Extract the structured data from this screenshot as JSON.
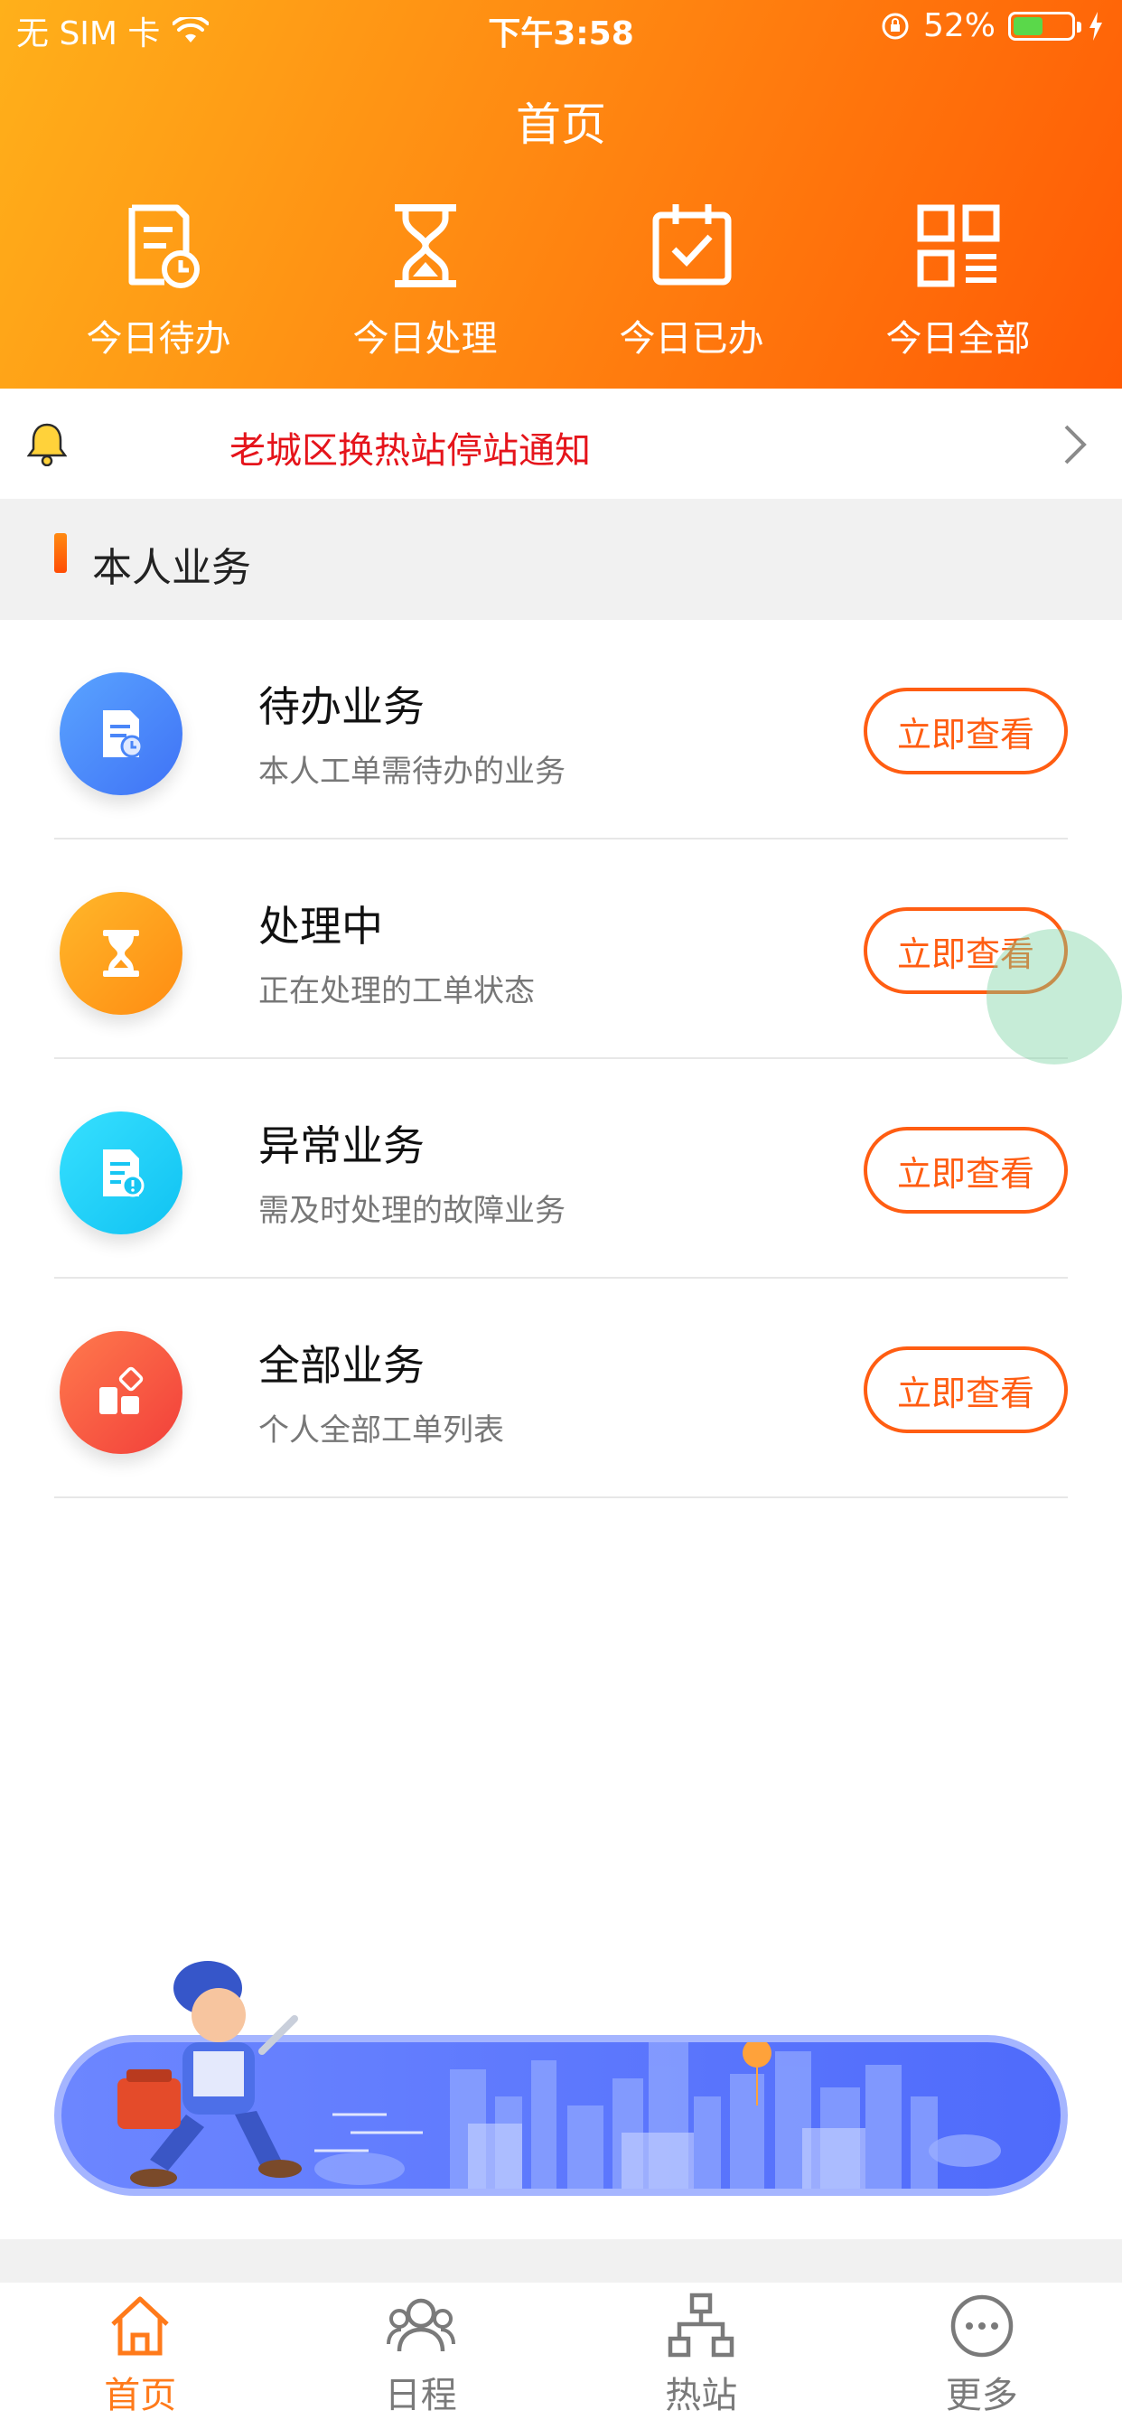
{
  "status_bar": {
    "carrier": "无 SIM 卡",
    "time": "下午3:58",
    "battery_percent": "52%",
    "battery_level": 0.52
  },
  "header": {
    "title": "首页",
    "quick_actions": [
      {
        "label": "今日待办",
        "icon": "document-clock-icon"
      },
      {
        "label": "今日处理",
        "icon": "hourglass-icon"
      },
      {
        "label": "今日已办",
        "icon": "calendar-check-icon"
      },
      {
        "label": "今日全部",
        "icon": "grid-menu-icon"
      }
    ]
  },
  "notice": {
    "text": "老城区换热站停站通知",
    "icon": "bell-icon"
  },
  "section": {
    "title": "本人业务"
  },
  "business": {
    "button_label": "立即查看",
    "items": [
      {
        "title": "待办业务",
        "desc": "本人工单需待办的业务",
        "icon": "document-clock-icon",
        "color_from": "#5aa4ff",
        "color_to": "#3f72f6"
      },
      {
        "title": "处理中",
        "desc": "正在处理的工单状态",
        "icon": "hourglass-icon",
        "color_from": "#ffb72a",
        "color_to": "#ff8c12"
      },
      {
        "title": "异常业务",
        "desc": "需及时处理的故障业务",
        "icon": "document-alert-icon",
        "color_from": "#37e0ff",
        "color_to": "#10c2f2"
      },
      {
        "title": "全部业务",
        "desc": "个人全部工单列表",
        "icon": "apps-icon",
        "color_from": "#ff7a4d",
        "color_to": "#f23f3a"
      }
    ]
  },
  "tabbar": {
    "items": [
      {
        "label": "首页",
        "icon": "home-icon",
        "active": true
      },
      {
        "label": "日程",
        "icon": "people-icon",
        "active": false
      },
      {
        "label": "热站",
        "icon": "network-icon",
        "active": false
      },
      {
        "label": "更多",
        "icon": "more-icon",
        "active": false
      }
    ]
  },
  "colors": {
    "accent": "#ff5d12",
    "notice_text": "#e5141b",
    "tab_active": "#ff7a1a",
    "tab_inactive": "#7a7a7a"
  }
}
